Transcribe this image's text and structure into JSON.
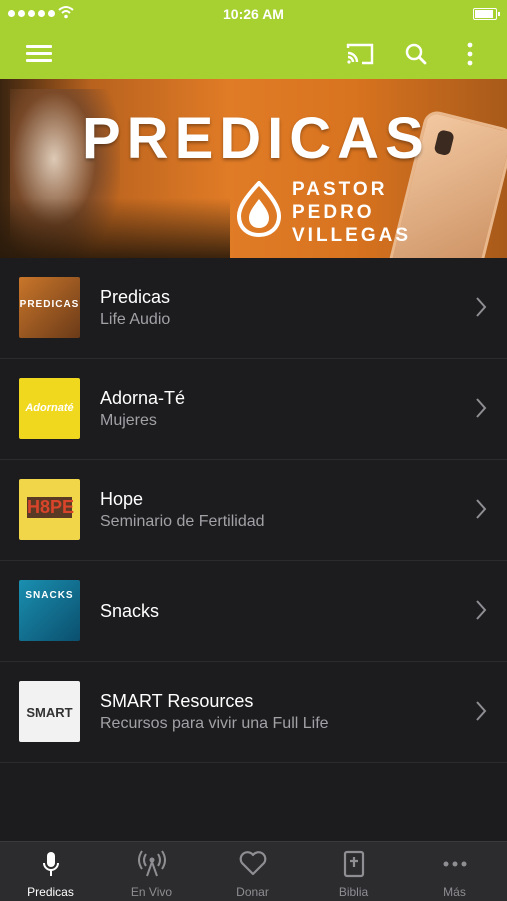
{
  "status_bar": {
    "time": "10:26 AM"
  },
  "colors": {
    "accent": "#a6d130",
    "background": "#1c1c1e",
    "tabbar": "#2c2c2e"
  },
  "toolbar": {
    "icons": [
      "menu-icon",
      "cast-icon",
      "search-icon",
      "more-vertical-icon"
    ]
  },
  "banner": {
    "title": "PREDICAS",
    "subtitle_lines": [
      "PASTOR",
      "PEDRO",
      "VILLEGAS"
    ]
  },
  "list": [
    {
      "title": "Predicas",
      "subtitle": "Life Audio",
      "thumb_text": "PREDICAS"
    },
    {
      "title": "Adorna-Té",
      "subtitle": "Mujeres",
      "thumb_text": "Adornaté"
    },
    {
      "title": "Hope",
      "subtitle": "Seminario de Fertilidad",
      "thumb_text": "H8PE"
    },
    {
      "title": "Snacks",
      "subtitle": "",
      "thumb_text": "SNACKS"
    },
    {
      "title": "SMART Resources",
      "subtitle": "Recursos para vivir una Full Life",
      "thumb_text": "SMART"
    }
  ],
  "tabs": [
    {
      "label": "Predicas",
      "icon": "microphone-icon",
      "active": true
    },
    {
      "label": "En Vivo",
      "icon": "broadcast-icon",
      "active": false
    },
    {
      "label": "Donar",
      "icon": "heart-icon",
      "active": false
    },
    {
      "label": "Biblia",
      "icon": "bible-icon",
      "active": false
    },
    {
      "label": "Más",
      "icon": "ellipsis-icon",
      "active": false
    }
  ]
}
